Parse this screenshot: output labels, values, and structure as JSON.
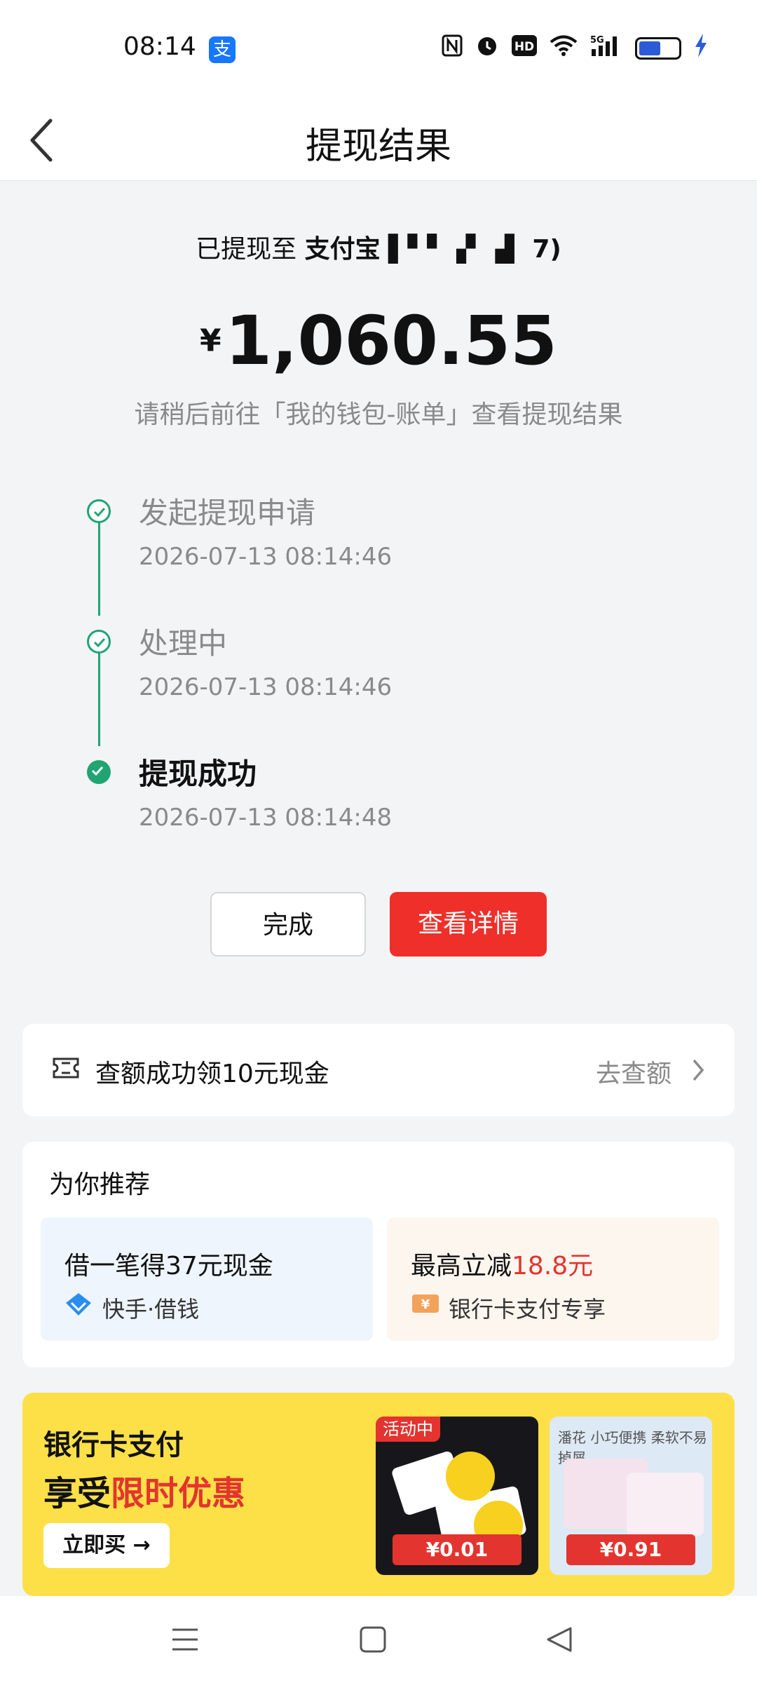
{
  "status_bar": {
    "time": "08:14",
    "app_badge": "支",
    "icons": [
      "nfc-icon",
      "alarm-icon",
      "hd-icon",
      "wifi-icon",
      "5g-signal-icon",
      "battery-icon",
      "charging-icon"
    ],
    "hd_label": "HD",
    "network_label": "5G"
  },
  "nav": {
    "title": "提现结果"
  },
  "result": {
    "dest_prefix": "已提现至",
    "dest_bold": "支付宝",
    "dest_suffix": "7)",
    "currency": "¥",
    "amount": "1,060.55",
    "hint": "请稍后前往「我的钱包-账单」查看提现结果"
  },
  "timeline": [
    {
      "title": "发起提现申请",
      "time": "2026-07-13 08:14:46",
      "state": "done"
    },
    {
      "title": "处理中",
      "time": "2026-07-13 08:14:46",
      "state": "done"
    },
    {
      "title": "提现成功",
      "time": "2026-07-13 08:14:48",
      "state": "current"
    }
  ],
  "buttons": {
    "done": "完成",
    "detail": "查看详情"
  },
  "credit_card": {
    "text": "查额成功领10元现金",
    "action": "去查额"
  },
  "recommend": {
    "heading": "为你推荐",
    "left": {
      "title": "借一笔得37元现金",
      "sub": "快手·借钱"
    },
    "right": {
      "title_prefix": "最高立减",
      "title_highlight": "18.8元",
      "sub": "银行卡支付专享"
    }
  },
  "banner": {
    "line1": "银行卡支付",
    "line2_prefix": "享受",
    "line2_highlight": "限时优惠",
    "buy": "立即买 →",
    "products": [
      {
        "tag": "活动中",
        "price": "¥0.01"
      },
      {
        "brand": "潘花  小巧便携 柔软不易掉屑",
        "price": "¥0.91"
      }
    ]
  },
  "colors": {
    "accent_red": "#ee2f2a",
    "success_green": "#20a572",
    "banner_yellow": "#fde047"
  }
}
